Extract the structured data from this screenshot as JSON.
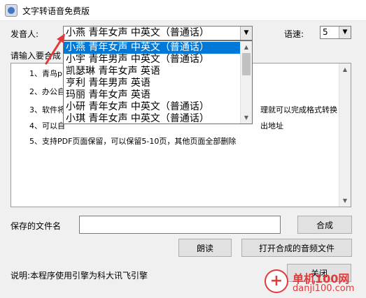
{
  "window": {
    "title": "文字转语音免费版"
  },
  "voice": {
    "label": "发音人:",
    "selected": "小燕 青年女声 中英文（普通话）",
    "options": [
      "小燕 青年女声 中英文（普通话）",
      "小宇 青年男声 中英文（普通话）",
      "凯瑟琳 青年女声 英语",
      "亨利 青年男声 英语",
      "玛丽 青年女声 英语",
      "小研 青年女声 中英文（普通话）",
      "小琪 青年女声 中英文（普通话）"
    ]
  },
  "speed": {
    "label": "语速:",
    "value": "5"
  },
  "input_label": "请输入要合成",
  "textarea": {
    "lines": [
      "1、青鸟p",
      "2、办公自",
      "3、软件将",
      "4、可以自",
      "5、支持PDF页面保留，可以保留5-10页，其他页面全部删除"
    ],
    "right_fragments": [
      {
        "line": 2,
        "text": "理就可以完成格式转换"
      },
      {
        "line": 3,
        "text": "出地址"
      }
    ]
  },
  "save": {
    "label": "保存的文件名",
    "value": "",
    "synth_label": "合成"
  },
  "read_label": "朗读",
  "open_audio_label": "打开合成的音频文件",
  "footer_note": "说明:本程序使用引擎为科大讯飞引擎",
  "close_label": "关闭",
  "watermark": {
    "text": "单机100网",
    "url": "danji100.com"
  },
  "colors": {
    "selection": "#0078d7",
    "arrow": "#e03a3a"
  },
  "icons": {
    "dropdown": "chevron-down-icon",
    "arrow": "red-arrow-icon"
  }
}
